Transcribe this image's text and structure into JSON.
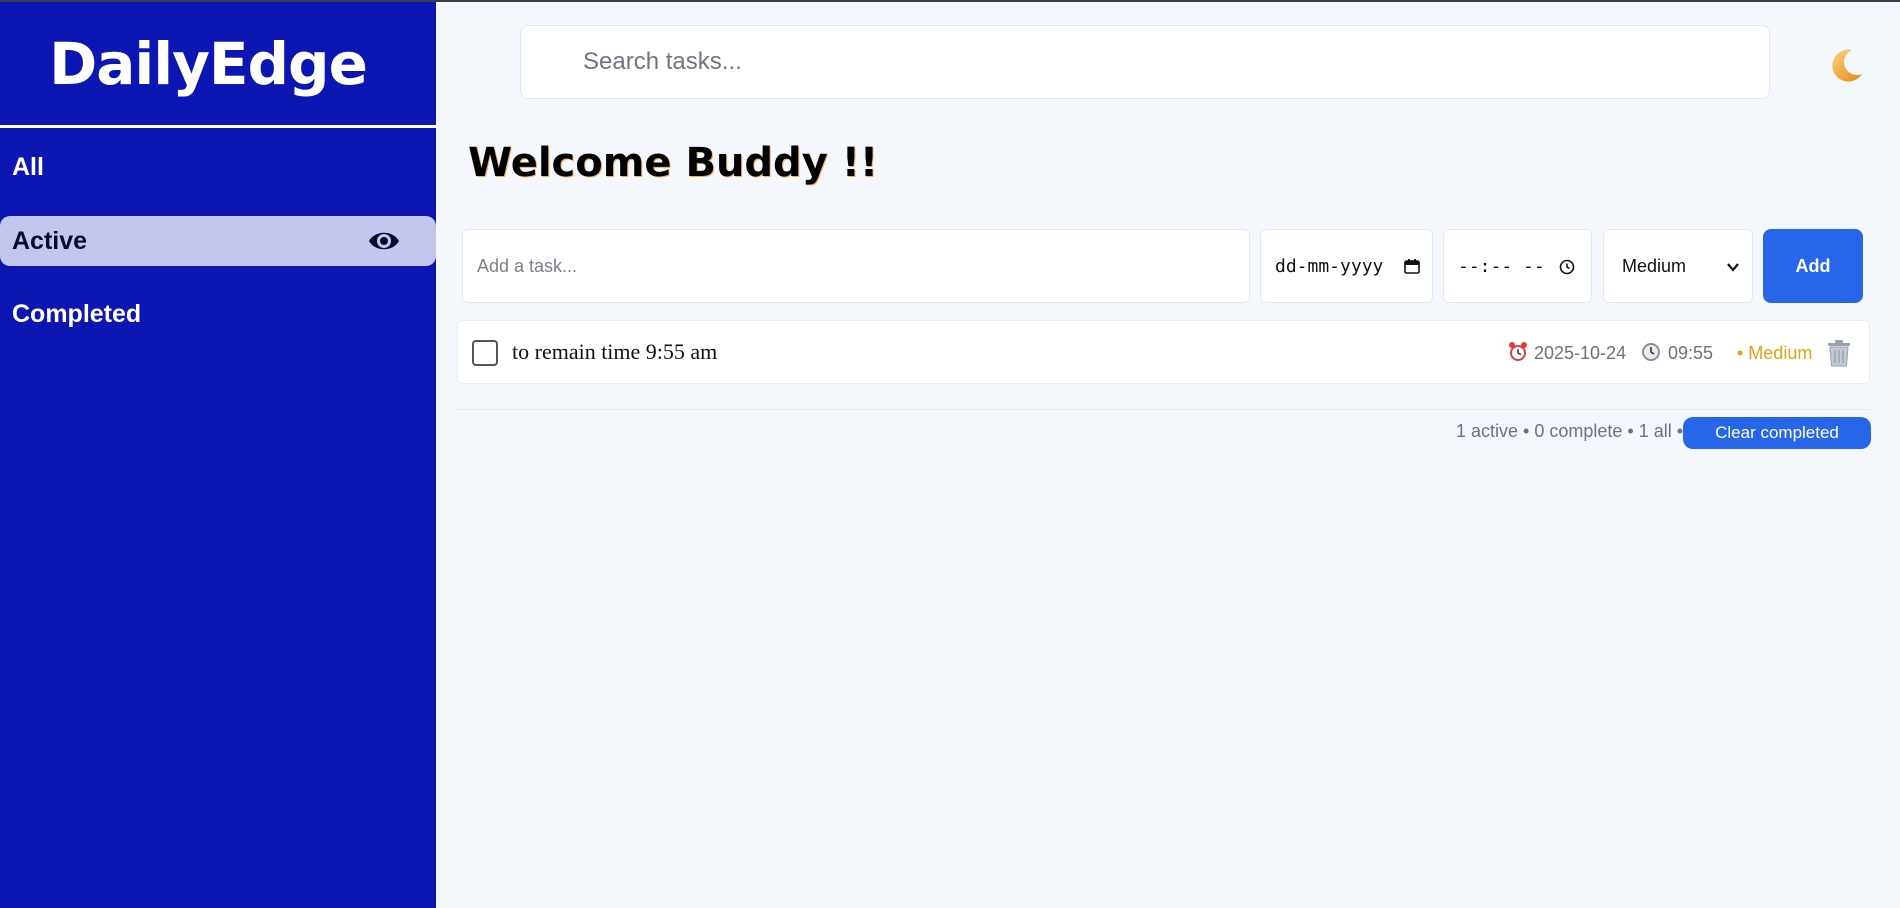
{
  "app": {
    "brand": "DailyEdge"
  },
  "sidebar": {
    "items": [
      {
        "label": "All"
      },
      {
        "label": "Active"
      },
      {
        "label": "Completed"
      }
    ]
  },
  "search": {
    "placeholder": "Search tasks..."
  },
  "header": {
    "theme_icon": "moon-icon"
  },
  "main": {
    "welcome": "Welcome Buddy !!",
    "form": {
      "task_placeholder": "Add a task...",
      "date_placeholder": "dd-mm-yyyy",
      "time_placeholder": "--:-- --",
      "priority_selected": "Medium",
      "add_label": "Add"
    },
    "tasks": [
      {
        "text": "to remain time 9:55 am",
        "date": "2025-10-24",
        "time": "09:55",
        "priority": "• Medium",
        "completed": false
      }
    ],
    "footer": {
      "stats": "1 active • 0 complete • 1 all •",
      "clear_label": "Clear completed"
    }
  },
  "colors": {
    "sidebar_bg": "#0c16b2",
    "accent": "#2766e8",
    "priority_medium": "#e2a414"
  }
}
